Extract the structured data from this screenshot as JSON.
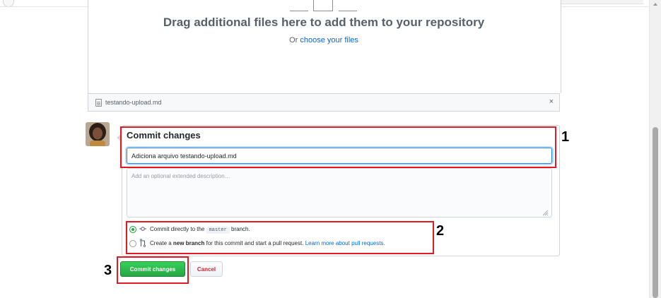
{
  "dropzone": {
    "title": "Drag additional files here to add them to your repository",
    "or_text": "Or",
    "choose_link": "choose your files"
  },
  "file": {
    "name": "testando-upload.md",
    "remove": "×"
  },
  "commit": {
    "heading": "Commit changes",
    "summary_value": "Adiciona arquivo testando-upload.md",
    "description_placeholder": "Add an optional extended description…",
    "option_direct": {
      "pre": "Commit directly to the",
      "branch": "master",
      "post": "branch.",
      "selected": true
    },
    "option_new": {
      "pre": "Create a",
      "bold": "new branch",
      "post": "for this commit and start a pull request.",
      "link": "Learn more about pull requests.",
      "selected": false
    },
    "commit_button": "Commit changes",
    "cancel_button": "Cancel"
  },
  "annotations": {
    "n1": "1",
    "n2": "2",
    "n3": "3"
  },
  "colors": {
    "highlight": "#e01b24",
    "primary_button": "#28a745",
    "cancel_text": "#cb2431",
    "link": "#0366d6"
  }
}
